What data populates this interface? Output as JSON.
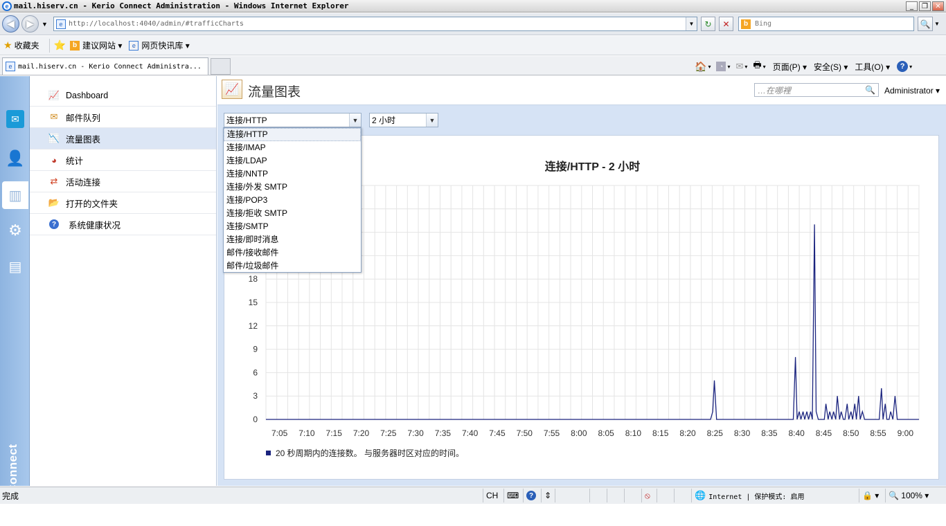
{
  "window": {
    "title": "mail.hiserv.cn - Kerio Connect Administration - Windows Internet Explorer",
    "logo_letter": "e"
  },
  "browser": {
    "url": "http://localhost:4040/admin/#trafficCharts",
    "search_placeholder": "Bing",
    "favorites_label": "收藏夹",
    "fav_links": [
      "建议网站 ▾",
      "网页快讯库 ▾"
    ],
    "tab_title": "mail.hiserv.cn - Kerio Connect Administra...",
    "commands": [
      "页面(P) ▾",
      "安全(S) ▾",
      "工具(O) ▾"
    ]
  },
  "app": {
    "brand": "KerioConnect",
    "nav": [
      {
        "label": "Dashboard",
        "icon": "dashboard-icon",
        "glyph": "📈"
      },
      {
        "label": "邮件队列",
        "icon": "mail-queue-icon",
        "glyph": "✉"
      },
      {
        "label": "流量图表",
        "icon": "traffic-chart-icon",
        "glyph": "📉"
      },
      {
        "label": "统计",
        "icon": "statistics-icon",
        "glyph": "◕"
      },
      {
        "label": "活动连接",
        "icon": "connections-icon",
        "glyph": "⇄"
      },
      {
        "label": "打开的文件夹",
        "icon": "folder-icon",
        "glyph": "📂"
      },
      {
        "label": "系统健康状况",
        "icon": "health-icon",
        "glyph": "?"
      }
    ],
    "page_title": "流量图表",
    "search_placeholder": "…在哪裡",
    "user": "Administrator ▾",
    "selected_chart": "连接/HTTP",
    "selected_period": "2 小时",
    "dropdown_options": [
      "连接/HTTP",
      "连接/IMAP",
      "连接/LDAP",
      "连接/NNTP",
      "连接/外发 SMTP",
      "连接/POP3",
      "连接/拒收 SMTP",
      "连接/SMTP",
      "连接/即时消息",
      "邮件/接收邮件",
      "邮件/垃圾邮件"
    ]
  },
  "chart_data": {
    "type": "line",
    "title": "连接/HTTP - 2 小时",
    "legend": "20 秒周期内的连接数。 与服务器时区对应的时间。",
    "series_color": "#1a237e",
    "x_tick_labels": [
      "7:05",
      "7:10",
      "7:15",
      "7:20",
      "7:25",
      "7:30",
      "7:35",
      "7:40",
      "7:45",
      "7:50",
      "7:55",
      "8:00",
      "8:05",
      "8:10",
      "8:15",
      "8:20",
      "8:25",
      "8:30",
      "8:35",
      "8:40",
      "8:45",
      "8:50",
      "8:55",
      "9:00"
    ],
    "y_tick_labels": [
      "0",
      "3",
      "6",
      "9",
      "12",
      "15",
      "18"
    ],
    "ylim": [
      0,
      30
    ],
    "x_range_minutes": [
      0,
      120
    ],
    "points": [
      [
        0,
        0
      ],
      [
        81.7,
        0
      ],
      [
        82.1,
        1
      ],
      [
        82.4,
        5
      ],
      [
        82.8,
        0
      ],
      [
        96.9,
        0
      ],
      [
        97.3,
        8
      ],
      [
        97.6,
        0
      ],
      [
        98,
        1
      ],
      [
        98.3,
        0
      ],
      [
        98.7,
        1
      ],
      [
        99,
        0
      ],
      [
        99.4,
        1
      ],
      [
        99.7,
        0
      ],
      [
        100.1,
        1
      ],
      [
        100.4,
        0
      ],
      [
        100.8,
        25
      ],
      [
        101.1,
        1
      ],
      [
        101.5,
        0
      ],
      [
        102.6,
        0
      ],
      [
        102.9,
        2
      ],
      [
        103.3,
        0
      ],
      [
        103.6,
        1
      ],
      [
        104,
        0
      ],
      [
        104.3,
        1
      ],
      [
        104.7,
        0
      ],
      [
        105,
        3
      ],
      [
        105.4,
        0
      ],
      [
        105.7,
        1
      ],
      [
        106.1,
        0
      ],
      [
        106.4,
        0
      ],
      [
        106.8,
        2
      ],
      [
        107.1,
        0
      ],
      [
        107.5,
        1
      ],
      [
        107.8,
        0
      ],
      [
        108.2,
        2
      ],
      [
        108.5,
        0
      ],
      [
        108.9,
        3
      ],
      [
        109.2,
        0
      ],
      [
        109.6,
        1
      ],
      [
        110,
        0
      ],
      [
        112.7,
        0
      ],
      [
        113.1,
        4
      ],
      [
        113.4,
        0
      ],
      [
        113.8,
        2
      ],
      [
        114.1,
        0
      ],
      [
        114.5,
        0
      ],
      [
        114.8,
        1
      ],
      [
        115.2,
        0
      ],
      [
        115.6,
        3
      ],
      [
        116,
        0
      ],
      [
        120,
        0
      ]
    ]
  }
}
